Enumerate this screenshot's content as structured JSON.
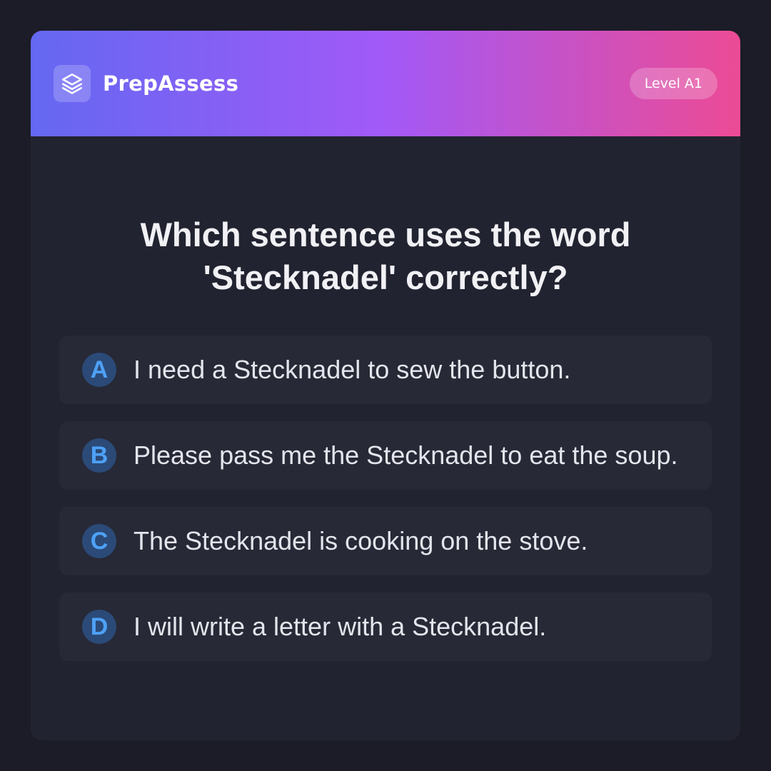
{
  "header": {
    "brand_name": "PrepAssess",
    "logo_icon": "layers-icon",
    "level_badge": "Level A1"
  },
  "question": {
    "text": "Which sentence uses the word 'Stecknadel' correctly?"
  },
  "options": [
    {
      "letter": "A",
      "text": "I need a Stecknadel to sew the button."
    },
    {
      "letter": "B",
      "text": "Please pass me the Stecknadel to eat the soup."
    },
    {
      "letter": "C",
      "text": "The Stecknadel is cooking on the stove."
    },
    {
      "letter": "D",
      "text": "I will write a letter with a Stecknadel."
    }
  ],
  "colors": {
    "header_gradient_start": "#6468f2",
    "header_gradient_mid": "#a259f7",
    "header_gradient_end": "#ec4b95",
    "option_letter": "#4ea1f7",
    "card_background": "#212330"
  }
}
